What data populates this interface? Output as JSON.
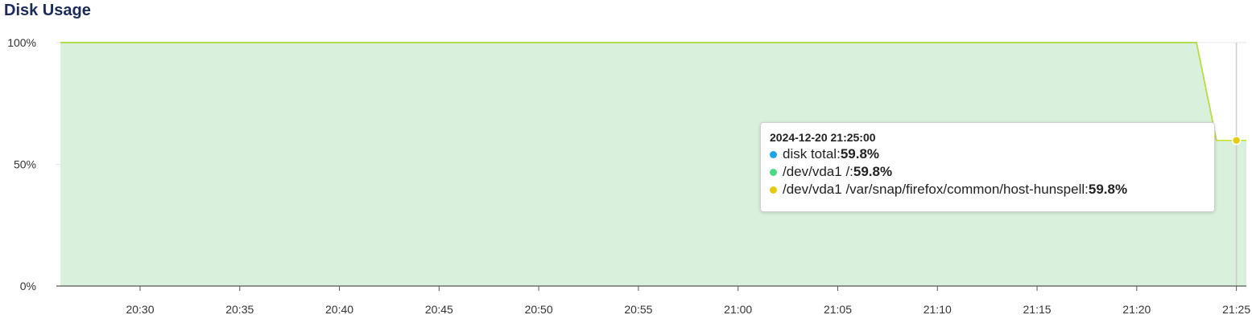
{
  "title": "Disk Usage",
  "chart_data": {
    "type": "area",
    "title": "Disk Usage",
    "xlabel": "",
    "ylabel": "",
    "ylim": [
      0,
      100
    ],
    "y_ticks": [
      "0%",
      "50%",
      "100%"
    ],
    "x_ticks": [
      "20:30",
      "20:35",
      "20:40",
      "20:45",
      "20:50",
      "20:55",
      "21:00",
      "21:05",
      "21:10",
      "21:15",
      "21:20",
      "21:25"
    ],
    "grid": true,
    "series": [
      {
        "name": "disk total",
        "color": "#1ba3e8",
        "x": [
          "20:26",
          "21:23",
          "21:24",
          "21:25",
          "21:25:30"
        ],
        "values": [
          100,
          100,
          59.8,
          59.8,
          59.8
        ]
      },
      {
        "name": "/dev/vda1 /",
        "color": "#4cd987",
        "x": [
          "20:26",
          "21:23",
          "21:24",
          "21:25",
          "21:25:30"
        ],
        "values": [
          100,
          100,
          59.8,
          59.8,
          59.8
        ]
      },
      {
        "name": "/dev/vda1 /var/snap/firefox/common/host-hunspell",
        "color": "#e5cc10",
        "x": [
          "20:26",
          "21:23",
          "21:24",
          "21:25",
          "21:25:30"
        ],
        "values": [
          100,
          100,
          59.8,
          59.8,
          59.8
        ]
      }
    ],
    "area_fill": "#d8f0dc",
    "line_color": "#c9e02a"
  },
  "tooltip": {
    "time": "2024-12-20 21:25:00",
    "rows": [
      {
        "label": "disk total: ",
        "value": "59.8%",
        "color": "#1ba3e8"
      },
      {
        "label": "/dev/vda1 /: ",
        "value": "59.8%",
        "color": "#4cd987"
      },
      {
        "label": "/dev/vda1 /var/snap/firefox/common/host-hunspell: ",
        "value": "59.8%",
        "color": "#e5cc10"
      }
    ]
  }
}
